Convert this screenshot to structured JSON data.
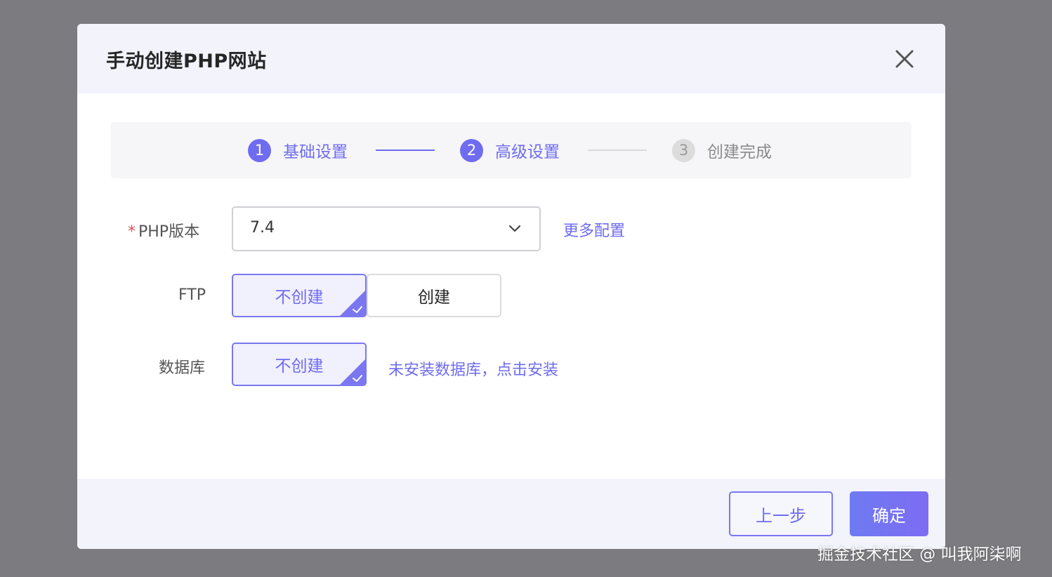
{
  "dialog": {
    "title": "手动创建PHP网站"
  },
  "steps": [
    {
      "num": "1",
      "label": "基础设置",
      "state": "done"
    },
    {
      "num": "2",
      "label": "高级设置",
      "state": "active"
    },
    {
      "num": "3",
      "label": "创建完成",
      "state": "pending"
    }
  ],
  "form": {
    "php_version": {
      "required_mark": "*",
      "label": "PHP版本",
      "value": "7.4",
      "more_link": "更多配置"
    },
    "ftp": {
      "label": "FTP",
      "options": [
        {
          "label": "不创建",
          "selected": true
        },
        {
          "label": "创建",
          "selected": false
        }
      ]
    },
    "database": {
      "label": "数据库",
      "options": [
        {
          "label": "不创建",
          "selected": true
        }
      ],
      "install_link": "未安装数据库，点击安装"
    }
  },
  "footer": {
    "prev_label": "上一步",
    "confirm_label": "确定"
  },
  "watermark": "掘金技术社区 @ 叫我阿柒啊",
  "colors": {
    "accent": "#6f6cf0",
    "header_bg": "#f2f3fb",
    "overlay": "#7b7b80",
    "required": "#e05050"
  }
}
